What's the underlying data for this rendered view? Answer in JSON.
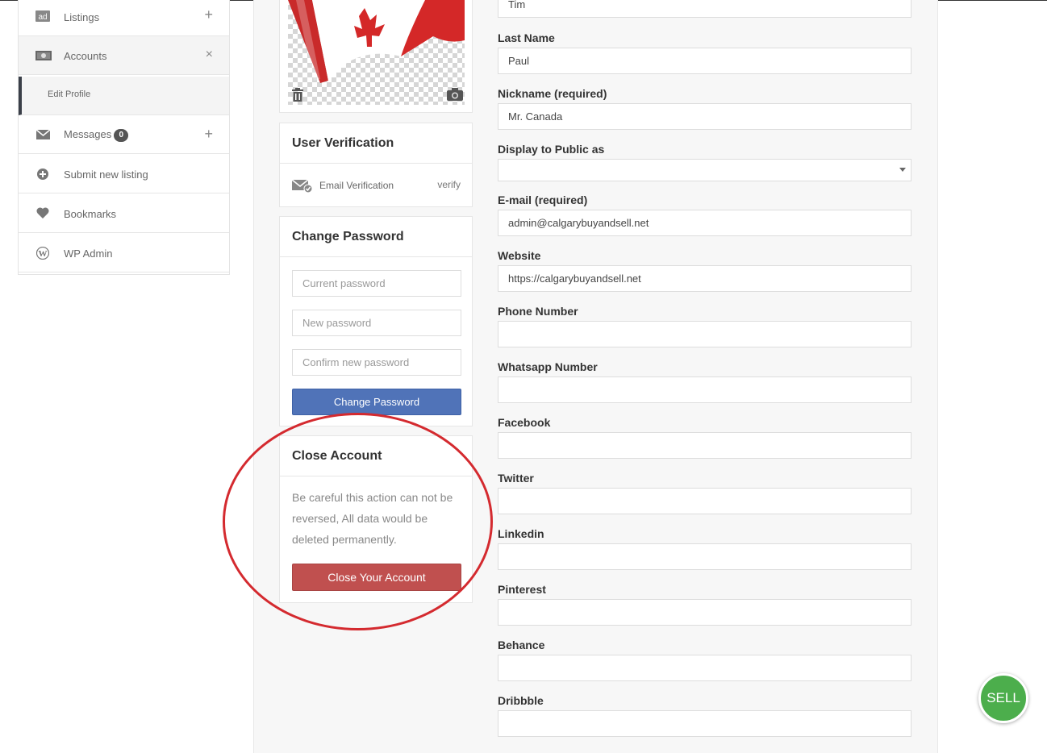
{
  "sidebar": {
    "items": [
      {
        "label": "Listings",
        "icon": "ad-icon",
        "action": "+"
      },
      {
        "label": "Accounts",
        "icon": "money-icon",
        "action": "×"
      },
      {
        "label": "Messages",
        "icon": "envelope-icon",
        "action": "+",
        "badge": "0"
      },
      {
        "label": "Submit new listing",
        "icon": "plus-circle-icon"
      },
      {
        "label": "Bookmarks",
        "icon": "heart-icon"
      },
      {
        "label": "WP Admin",
        "icon": "wordpress-icon"
      }
    ],
    "sub_item": "Edit Profile"
  },
  "verification": {
    "title": "User Verification",
    "email_label": "Email Verification",
    "verify_link": "verify"
  },
  "password": {
    "title": "Change Password",
    "current_placeholder": "Current password",
    "new_placeholder": "New password",
    "confirm_placeholder": "Confirm new password",
    "button": "Change Password"
  },
  "close_account": {
    "title": "Close Account",
    "warning": "Be careful this action can not be reversed, All data would be deleted permanently.",
    "button": "Close Your Account"
  },
  "form": {
    "first_name_value": "Tim",
    "last_name_label": "Last Name",
    "last_name_value": "Paul",
    "nickname_label": "Nickname (required)",
    "nickname_value": "Mr. Canada",
    "display_label": "Display to Public as",
    "email_label": "E-mail (required)",
    "email_value": "admin@calgarybuyandsell.net",
    "website_label": "Website",
    "website_value": "https://calgarybuyandsell.net",
    "phone_label": "Phone Number",
    "whatsapp_label": "Whatsapp Number",
    "facebook_label": "Facebook",
    "twitter_label": "Twitter",
    "linkedin_label": "Linkedin",
    "pinterest_label": "Pinterest",
    "behance_label": "Behance",
    "dribbble_label": "Dribbble"
  },
  "sell_button": "SELL",
  "colors": {
    "primary_blue": "#5073b8",
    "danger_red": "#c0504f",
    "sell_green": "#4cae4c",
    "annotation_red": "#d42a2f"
  }
}
